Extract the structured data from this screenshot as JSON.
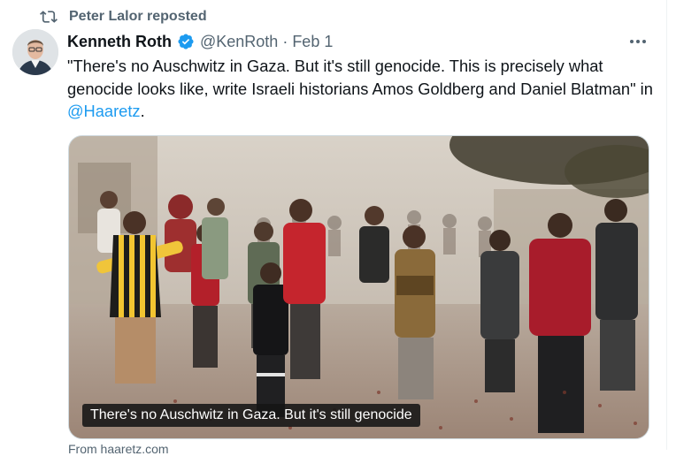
{
  "repost": {
    "label": "Peter Lalor reposted",
    "icon": "repost-icon"
  },
  "post": {
    "author_name": "Kenneth Roth",
    "verified": true,
    "handle": "@KenRoth",
    "separator": "·",
    "date": "Feb 1",
    "text_main": "\"There's no Auschwitz in Gaza. But it's still genocide. This is precisely what genocide looks like, write Israeli historians Amos Goldberg and Daniel Blatman\" in ",
    "mention": "@Haaretz",
    "text_end": ".",
    "media_caption": "There's no Auschwitz in Gaza. But it's still genocide",
    "link_domain": "From haaretz.com"
  },
  "colors": {
    "accent": "#1d9bf0",
    "secondary_text": "#536471",
    "primary_text": "#0f1419"
  }
}
